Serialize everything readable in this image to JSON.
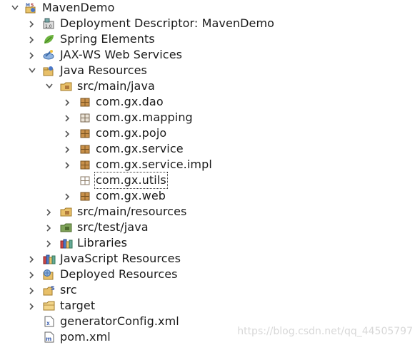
{
  "tree": {
    "root": {
      "label": "MavenDemo",
      "icon": "maven-project-icon",
      "expanded": true
    },
    "items": [
      {
        "label": "Deployment Descriptor: MavenDemo",
        "icon": "deployment-descriptor-icon",
        "expanded": false
      },
      {
        "label": "Spring Elements",
        "icon": "spring-leaf-icon",
        "expanded": false
      },
      {
        "label": "JAX-WS Web Services",
        "icon": "web-services-icon",
        "expanded": false
      },
      {
        "label": "Java Resources",
        "icon": "java-resources-icon",
        "expanded": true
      },
      {
        "label": "src/main/java",
        "icon": "source-folder-icon",
        "expanded": true
      },
      {
        "label": "com.gx.dao",
        "icon": "package-icon",
        "expanded": false
      },
      {
        "label": "com.gx.mapping",
        "icon": "package-icon",
        "expanded": false
      },
      {
        "label": "com.gx.pojo",
        "icon": "package-icon",
        "expanded": false
      },
      {
        "label": "com.gx.service",
        "icon": "package-icon",
        "expanded": false
      },
      {
        "label": "com.gx.service.impl",
        "icon": "package-icon",
        "expanded": false
      },
      {
        "label": "com.gx.utils",
        "icon": "empty-package-icon",
        "selected": true
      },
      {
        "label": "com.gx.web",
        "icon": "package-icon",
        "expanded": false
      },
      {
        "label": "src/main/resources",
        "icon": "source-folder-icon",
        "expanded": false
      },
      {
        "label": "src/test/java",
        "icon": "source-folder-icon",
        "expanded": false
      },
      {
        "label": "Libraries",
        "icon": "libraries-icon",
        "expanded": false
      },
      {
        "label": "JavaScript Resources",
        "icon": "javascript-resources-icon",
        "expanded": false
      },
      {
        "label": "Deployed Resources",
        "icon": "deployed-resources-icon",
        "expanded": false
      },
      {
        "label": "src",
        "icon": "src-folder-icon",
        "expanded": false
      },
      {
        "label": "target",
        "icon": "folder-icon",
        "expanded": false
      },
      {
        "label": "generatorConfig.xml",
        "icon": "xml-file-icon"
      },
      {
        "label": "pom.xml",
        "icon": "maven-pom-icon"
      }
    ]
  },
  "watermark": "https://blog.csdn.net/qq_44505797",
  "colors": {
    "package": "#b07a3c",
    "folder": "#e8c069",
    "spring": "#6db33f",
    "chevron": "#555555"
  }
}
